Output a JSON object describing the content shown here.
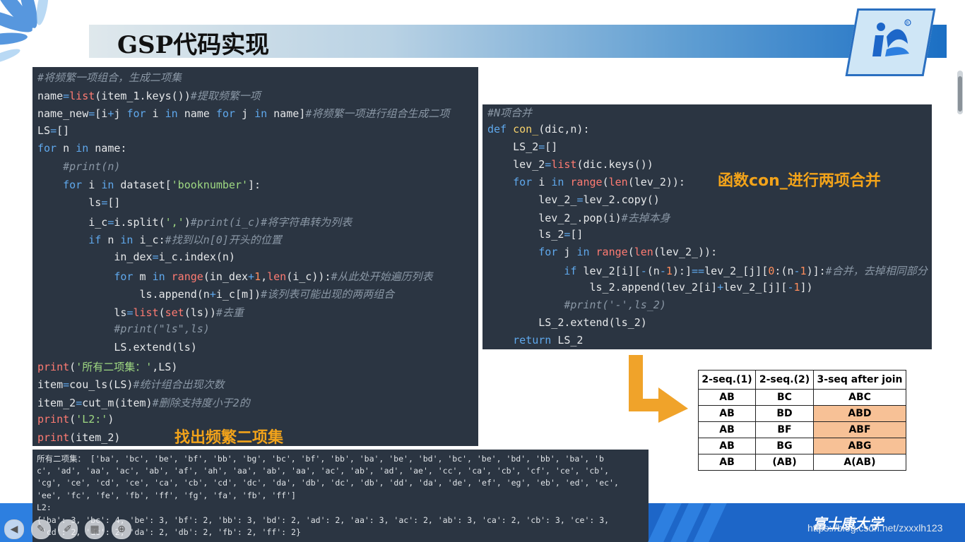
{
  "slide": {
    "title": "GSP代码实现"
  },
  "code_left": [
    [
      [
        "cm",
        "#将频繁一项组合，生成二项集"
      ]
    ],
    [
      [
        "t",
        "name"
      ],
      [
        "kw",
        "="
      ],
      [
        "fn",
        "list"
      ],
      [
        "t",
        "(item_1.keys())"
      ],
      [
        "cm",
        "#提取频繁一项"
      ]
    ],
    [
      [
        "t",
        "name_new"
      ],
      [
        "kw",
        "="
      ],
      [
        "t",
        "[i"
      ],
      [
        "kw",
        "+"
      ],
      [
        "t",
        "j "
      ],
      [
        "kw",
        "for"
      ],
      [
        "t",
        " i "
      ],
      [
        "kw",
        "in"
      ],
      [
        "t",
        " name "
      ],
      [
        "kw",
        "for"
      ],
      [
        "t",
        " j "
      ],
      [
        "kw",
        "in"
      ],
      [
        "t",
        " name]"
      ],
      [
        "cm",
        "#将频繁一项进行组合生成二项"
      ]
    ],
    [
      [
        "t",
        "LS"
      ],
      [
        "kw",
        "="
      ],
      [
        "t",
        "[]"
      ]
    ],
    [
      [
        "kw",
        "for"
      ],
      [
        "t",
        " n "
      ],
      [
        "kw",
        "in"
      ],
      [
        "t",
        " name:"
      ]
    ],
    [
      [
        "t",
        "    "
      ],
      [
        "cm",
        "#print(n)"
      ]
    ],
    [
      [
        "t",
        "    "
      ],
      [
        "kw",
        "for"
      ],
      [
        "t",
        " i "
      ],
      [
        "kw",
        "in"
      ],
      [
        "t",
        " dataset["
      ],
      [
        "str",
        "'booknumber'"
      ],
      [
        "t",
        "]:"
      ]
    ],
    [
      [
        "t",
        "        ls"
      ],
      [
        "kw",
        "="
      ],
      [
        "t",
        "[]"
      ]
    ],
    [
      [
        "t",
        "        i_c"
      ],
      [
        "kw",
        "="
      ],
      [
        "t",
        "i.split("
      ],
      [
        "str",
        "','"
      ],
      [
        "t",
        ")"
      ],
      [
        "cm",
        "#print(i_c)#将字符串转为列表"
      ]
    ],
    [
      [
        "t",
        "        "
      ],
      [
        "kw",
        "if"
      ],
      [
        "t",
        " n "
      ],
      [
        "kw",
        "in"
      ],
      [
        "t",
        " i_c:"
      ],
      [
        "cm",
        "#找到以n[0]开头的位置"
      ]
    ],
    [
      [
        "t",
        "            in_dex"
      ],
      [
        "kw",
        "="
      ],
      [
        "t",
        "i_c.index(n)"
      ]
    ],
    [
      [
        "t",
        "            "
      ],
      [
        "kw",
        "for"
      ],
      [
        "t",
        " m "
      ],
      [
        "kw",
        "in"
      ],
      [
        "t",
        " "
      ],
      [
        "fn",
        "range"
      ],
      [
        "t",
        "(in_dex"
      ],
      [
        "kw",
        "+"
      ],
      [
        "num",
        "1"
      ],
      [
        "t",
        ","
      ],
      [
        "fn",
        "len"
      ],
      [
        "t",
        "(i_c)):"
      ],
      [
        "cm",
        "#从此处开始遍历列表"
      ]
    ],
    [
      [
        "t",
        "                ls.append(n"
      ],
      [
        "kw",
        "+"
      ],
      [
        "t",
        "i_c[m])"
      ],
      [
        "cm",
        "#该列表可能出现的两两组合"
      ]
    ],
    [
      [
        "t",
        "            ls"
      ],
      [
        "kw",
        "="
      ],
      [
        "fn",
        "list"
      ],
      [
        "t",
        "("
      ],
      [
        "fn",
        "set"
      ],
      [
        "t",
        "(ls))"
      ],
      [
        "cm",
        "#去重"
      ]
    ],
    [
      [
        "t",
        "            "
      ],
      [
        "cm",
        "#print(\"ls\",ls)"
      ]
    ],
    [
      [
        "t",
        "            LS.extend(ls)"
      ]
    ],
    [
      [
        "fn",
        "print"
      ],
      [
        "t",
        "("
      ],
      [
        "str",
        "'所有二项集：'"
      ],
      [
        "t",
        ",LS)"
      ]
    ],
    [
      [
        "t",
        "item"
      ],
      [
        "kw",
        "="
      ],
      [
        "t",
        "cou_ls(LS)"
      ],
      [
        "cm",
        "#统计组合出现次数"
      ]
    ],
    [
      [
        "t",
        "item_2"
      ],
      [
        "kw",
        "="
      ],
      [
        "t",
        "cut_m(item)"
      ],
      [
        "cm",
        "#删除支持度小于2的"
      ]
    ],
    [
      [
        "fn",
        "print"
      ],
      [
        "t",
        "("
      ],
      [
        "str",
        "'L2:'"
      ],
      [
        "t",
        ")"
      ]
    ],
    [
      [
        "fn",
        "print"
      ],
      [
        "t",
        "(item_2)"
      ]
    ]
  ],
  "code_right": [
    [
      [
        "cm",
        "#N项合并"
      ]
    ],
    [
      [
        "kw",
        "def"
      ],
      [
        "t",
        " "
      ],
      [
        "def",
        "con_"
      ],
      [
        "t",
        "(dic,n):"
      ]
    ],
    [
      [
        "t",
        "    LS_2"
      ],
      [
        "kw",
        "="
      ],
      [
        "t",
        "[]"
      ]
    ],
    [
      [
        "t",
        "    lev_2"
      ],
      [
        "kw",
        "="
      ],
      [
        "fn",
        "list"
      ],
      [
        "t",
        "(dic.keys())"
      ]
    ],
    [
      [
        "t",
        "    "
      ],
      [
        "kw",
        "for"
      ],
      [
        "t",
        " i "
      ],
      [
        "kw",
        "in"
      ],
      [
        "t",
        " "
      ],
      [
        "fn",
        "range"
      ],
      [
        "t",
        "("
      ],
      [
        "fn",
        "len"
      ],
      [
        "t",
        "(lev_2)):"
      ]
    ],
    [
      [
        "t",
        "        lev_2_"
      ],
      [
        "kw",
        "="
      ],
      [
        "t",
        "lev_2.copy()"
      ]
    ],
    [
      [
        "t",
        "        lev_2_.pop(i)"
      ],
      [
        "cm",
        "#去掉本身"
      ]
    ],
    [
      [
        "t",
        "        ls_2"
      ],
      [
        "kw",
        "="
      ],
      [
        "t",
        "[]"
      ]
    ],
    [
      [
        "t",
        "        "
      ],
      [
        "kw",
        "for"
      ],
      [
        "t",
        " j "
      ],
      [
        "kw",
        "in"
      ],
      [
        "t",
        " "
      ],
      [
        "fn",
        "range"
      ],
      [
        "t",
        "("
      ],
      [
        "fn",
        "len"
      ],
      [
        "t",
        "(lev_2_)):"
      ]
    ],
    [
      [
        "t",
        "            "
      ],
      [
        "kw",
        "if"
      ],
      [
        "t",
        " lev_2[i]["
      ],
      [
        "kw",
        "-"
      ],
      [
        "t",
        "(n"
      ],
      [
        "kw",
        "-"
      ],
      [
        "num",
        "1"
      ],
      [
        "t",
        "):]"
      ],
      [
        "kw",
        "=="
      ],
      [
        "t",
        "lev_2_[j]["
      ],
      [
        "num",
        "0"
      ],
      [
        "t",
        ":(n"
      ],
      [
        "kw",
        "-"
      ],
      [
        "num",
        "1"
      ],
      [
        "t",
        ")]:"
      ],
      [
        "cm",
        "#合并，去掉相同部分"
      ]
    ],
    [
      [
        "t",
        "                ls_2.append(lev_2[i]"
      ],
      [
        "kw",
        "+"
      ],
      [
        "t",
        "lev_2_[j]["
      ],
      [
        "kw",
        "-"
      ],
      [
        "num",
        "1"
      ],
      [
        "t",
        "])"
      ]
    ],
    [
      [
        "t",
        "            "
      ],
      [
        "cm",
        "#print('-',ls_2)"
      ]
    ],
    [
      [
        "t",
        "        LS_2.extend(ls_2)"
      ]
    ],
    [
      [
        "t",
        "    "
      ],
      [
        "kw",
        "return"
      ],
      [
        "t",
        " LS_2"
      ]
    ]
  ],
  "output_lines": [
    "所有二项集： ['ba', 'bc', 'be', 'bf', 'bb', 'bg', 'bc', 'bf', 'bb', 'ba', 'be', 'bd', 'bc', 'be', 'bd', 'bb', 'ba', 'b",
    "c', 'ad', 'aa', 'ac', 'ab', 'af', 'ah', 'aa', 'ab', 'aa', 'ac', 'ab', 'ad', 'ae', 'cc', 'ca', 'cb', 'cf', 'ce', 'cb',",
    "'cg', 'ce', 'cd', 'ce', 'ca', 'cb', 'cd', 'dc', 'da', 'db', 'dc', 'db', 'dd', 'da', 'de', 'ef', 'eg', 'eb', 'ed', 'ec',",
    "'ee', 'fc', 'fe', 'fb', 'ff', 'fg', 'fa', 'fb', 'ff']",
    "L2:",
    "{'ba': 3, 'bc': 4, 'be': 3, 'bf': 2, 'bb': 3, 'bd': 2, 'ad': 2, 'aa': 3, 'ac': 2, 'ab': 3, 'ca': 2, 'cb': 3, 'ce': 3,",
    " 'cd': 2, 'dc': 2, 'da': 2, 'db': 2, 'fb': 2, 'ff': 2}"
  ],
  "captions": {
    "left": "找出频繁二项集",
    "right": "函数con_进行两项合并"
  },
  "join_table": {
    "headers": [
      "2-seq.(1)",
      "2-seq.(2)",
      "3-seq after join"
    ],
    "rows": [
      [
        "AB",
        "BC",
        "ABC"
      ],
      [
        "AB",
        "BD",
        "ABD"
      ],
      [
        "AB",
        "BF",
        "ABF"
      ],
      [
        "AB",
        "BG",
        "ABG"
      ],
      [
        "AB",
        "(AB)",
        "A(AB)"
      ]
    ],
    "highlighted_rows": [
      1,
      2,
      3
    ],
    "highlight_color": "#f7c196"
  },
  "footer": {
    "university": "富士康大学",
    "watermark": "https://blog.csdn.net/zxxxlh123"
  },
  "colors": {
    "code_bg": "#2b3542",
    "caption": "#f2a31a",
    "arrow": "#f0a32a",
    "footer_blue": "#1d66c8"
  }
}
